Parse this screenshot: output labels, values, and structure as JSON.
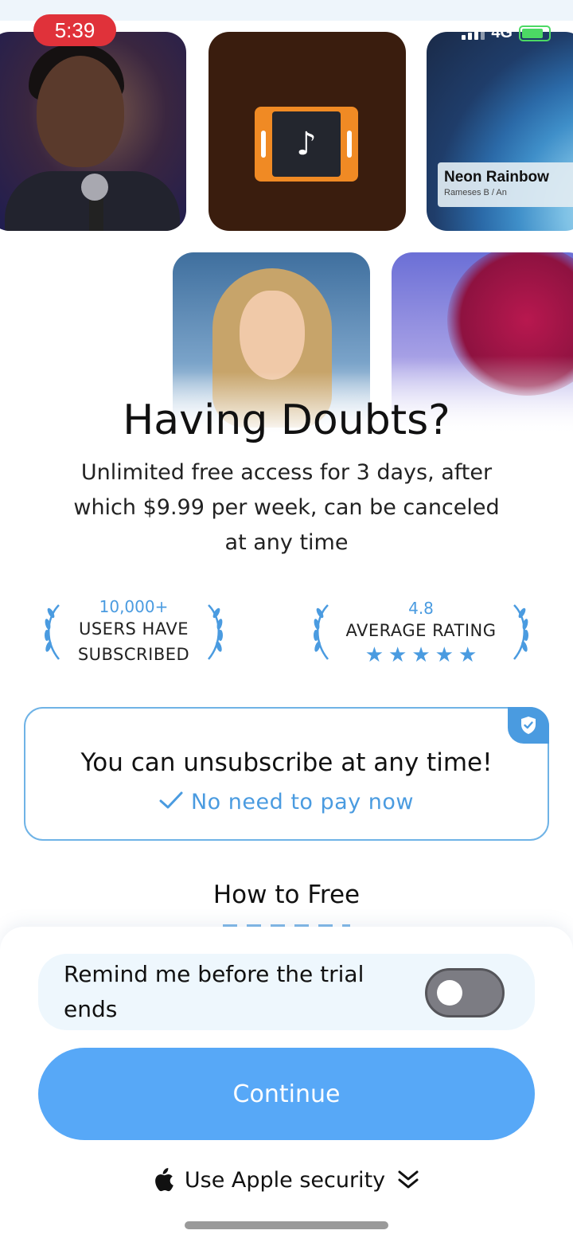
{
  "status_bar": {
    "time": "5:39",
    "network": "4G"
  },
  "covers": {
    "card_title": "Neon Rainbow",
    "card_subtitle": "Rameses B / An"
  },
  "headline": "Having Doubts?",
  "subline": "Unlimited free access for 3 days, after which $9.99 per week, can be canceled at any time",
  "stats": [
    {
      "value": "10,000+",
      "label_line1": "USERS HAVE",
      "label_line2": "SUBSCRIBED"
    },
    {
      "value": "4.8",
      "label_line1": "AVERAGE RATING",
      "stars": 5
    }
  ],
  "promise": {
    "title": "You can unsubscribe at any time!",
    "subtitle": "No need to pay now"
  },
  "how_to_title": "How to Free",
  "reminder": {
    "label": "Remind me before the trial ends",
    "enabled": false
  },
  "continue_label": "Continue",
  "security_label": "Use Apple security",
  "colors": {
    "accent": "#4a9be0",
    "button": "#57a8f7",
    "time_pill": "#e0323a"
  },
  "icons": [
    "music-note-icon",
    "shield-check-icon",
    "checkmark-icon",
    "star-icon",
    "apple-logo-icon",
    "double-chevron-down-icon",
    "laurel-icon"
  ]
}
